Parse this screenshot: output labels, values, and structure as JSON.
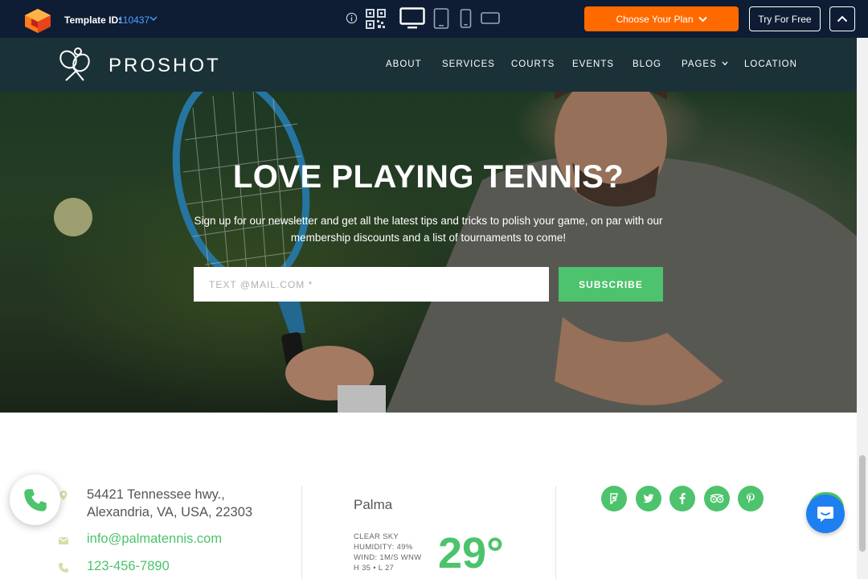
{
  "builder": {
    "template_label": "Template ID:",
    "template_id": "110437",
    "plan_button": "Choose Your Plan",
    "free_button": "Try For Free",
    "brand_colors": {
      "bar": "#0e1d33",
      "plan": "#ff6a00",
      "id_link": "#4aa3ff"
    }
  },
  "site": {
    "name": "PROSHOT",
    "nav": [
      "ABOUT",
      "SERVICES",
      "COURTS",
      "EVENTS",
      "BLOG",
      "PAGES",
      "LOCATION"
    ]
  },
  "hero": {
    "title": "LOVE PLAYING TENNIS?",
    "subtitle": "Sign up for our newsletter and get all the latest tips and tricks to polish your game, on par with our membership discounts and a list of tournaments to come!",
    "email_placeholder": "TEXT @MAIL.COM *",
    "subscribe_label": "SUBSCRIBE",
    "accent": "#4cc36c"
  },
  "contact": {
    "address_line1": "54421 Tennessee hwy.,",
    "address_line2": "Alexandria, VA, USA, 22303",
    "email": "info@palmatennis.com",
    "phone": "123-456-7890"
  },
  "weather": {
    "city": "Palma",
    "condition": "CLEAR SKY",
    "humidity": "HUMIDITY: 49%",
    "wind": "WIND: 1M/S WNW",
    "hilo": "H 35 • L 27",
    "temperature": "29°"
  },
  "social_icons": [
    "foursquare-icon",
    "twitter-icon",
    "facebook-icon",
    "tripadvisor-icon",
    "pinterest-icon"
  ]
}
